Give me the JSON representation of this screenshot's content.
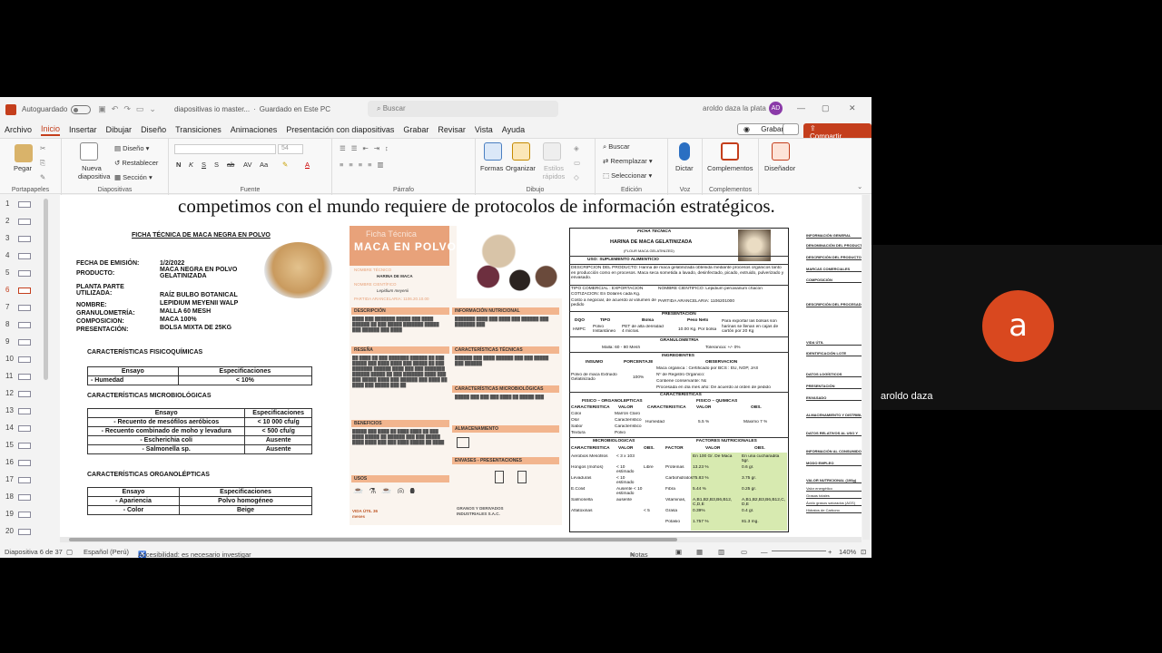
{
  "titlebar": {
    "autosave": "Autoguardado",
    "filename": "diapositivas io master...",
    "saved": "Guardado en Este PC",
    "search_placeholder": "Buscar",
    "user": "aroldo daza la plata",
    "avatar_initials": "AD"
  },
  "menu": {
    "items": [
      "Archivo",
      "Inicio",
      "Insertar",
      "Dibujar",
      "Diseño",
      "Transiciones",
      "Animaciones",
      "Presentación con diapositivas",
      "Grabar",
      "Revisar",
      "Vista",
      "Ayuda"
    ],
    "active": "Inicio",
    "grabar": "Grabar",
    "compartir": "Compartir"
  },
  "ribbon": {
    "pegar": "Pegar",
    "portapapeles": "Portapapeles",
    "nueva_diapositiva": "Nueva diapositiva",
    "diseno": "Diseño",
    "restablecer": "Restablecer",
    "seccion": "Sección",
    "diapositivas": "Diapositivas",
    "fuente": "Fuente",
    "font_size": "54",
    "parrafo": "Párrafo",
    "formas": "Formas",
    "organizar": "Organizar",
    "estilos_rapidos": "Estilos rápidos",
    "dibujo": "Dibujo",
    "buscar": "Buscar",
    "reemplazar": "Reemplazar",
    "seleccionar": "Seleccionar",
    "edicion": "Edición",
    "dictar": "Dictar",
    "voz": "Voz",
    "complementos": "Complementos",
    "complementos_group": "Complementos",
    "disenador": "Diseñador"
  },
  "thumbnails": [
    "1",
    "2",
    "3",
    "4",
    "5",
    "6",
    "7",
    "8",
    "9",
    "10",
    "11",
    "12",
    "13",
    "14",
    "15",
    "16",
    "17",
    "18",
    "19",
    "20"
  ],
  "selected_thumbnail": "6",
  "slide": {
    "heading": "competimos con el mundo requiere de protocolos de  información estratégicos.",
    "doc1": {
      "title": "FICHA TÉCNICA DE MACA NEGRA EN POLVO",
      "fields": [
        {
          "label": "FECHA DE EMISIÓN:",
          "value": "1/2/2022"
        },
        {
          "label": "PRODUCTO:",
          "value": "MACA NEGRA EN POLVO GELATINIZADA"
        },
        {
          "label": "PLANTA PARTE UTILIZADA:",
          "value": "RAÍZ BULBO BOTANICAL"
        },
        {
          "label": "NOMBRE:",
          "value": "LEPIDIUM MEYENII WALP"
        },
        {
          "label": "GRANULOMETRÍA:",
          "value": "MALLA 60 MESH"
        },
        {
          "label": "COMPOSICION:",
          "value": "MACA 100%"
        },
        {
          "label": "PRESENTACIÓN:",
          "value": "BOLSA MIXTA DE 25KG"
        }
      ],
      "fisico_title": "CARACTERÍSTICAS FISICOQUÍMICAS",
      "fisico_headers": [
        "Ensayo",
        "Especificaciones"
      ],
      "fisico_rows": [
        [
          "- Humedad",
          "< 10%"
        ]
      ],
      "micro_title": "CARACTERÍSTICAS MICROBIOLÓGICAS",
      "micro_headers": [
        "Ensayo",
        "Especificaciones"
      ],
      "micro_rows": [
        [
          "- Recuento de mesófilos aeróbicos",
          "< 10 000 cfu/g"
        ],
        [
          "- Recuento combinado de moho y levadura",
          "< 500 cfu/g"
        ],
        [
          "- Escherichia coli",
          "Ausente"
        ],
        [
          "- Salmonella sp.",
          "Ausente"
        ]
      ],
      "organo_title": "CARACTERÍSTICAS ORGANOLÉPTICAS",
      "organo_headers": [
        "Ensayo",
        "Especificaciones"
      ],
      "organo_rows": [
        [
          "- Apariencia",
          "Polvo homogéneo"
        ],
        [
          "- Color",
          "Beige"
        ]
      ]
    },
    "doc2": {
      "banner_small": "Ficha Técnica",
      "banner_big": "MACA EN POLVO",
      "nombre_tecnico_label": "NOMBRE TÉCNICO",
      "nombre_tecnico": "HARINA DE MACA",
      "nombre_cientifico_label": "NOMBRE CIENTÍFICO",
      "nombre_cientifico": "Lepidium meyenii",
      "partida": "PARTIDA ARANCELARIA: 1106.20.10.00",
      "sections": [
        "DESCRIPCIÓN",
        "INFORMACIÓN NUTRICIONAL",
        "RESEÑA",
        "CARACTERÍSTICAS TÉCNICAS",
        "CARACTERÍSTICAS MICROBIOLÓGICAS",
        "BENEFICIOS",
        "ALMACENAMIENTO",
        "ENVASES - PRESENTACIONES",
        "USOS"
      ],
      "vida_util": "VIDA ÚTIL 36 meses",
      "company": "GRANOS Y DERIVADOS INDUSTRIALES S.A.C."
    },
    "doc3": {
      "title": "FICHA TECNICA",
      "product": "HARINA DE MACA GELATINIZADA",
      "flour": "(FLOUR MACA GELATINIZED)",
      "uso": "USO: SUPLEMENTO ALIMENTICIO",
      "descripcion": "DESCRIPCION DEL PRODUCTO: Harina de maca gelatinizada obtenida mediante procesos orgánicos tanto en producción como en procesos. Maca seca sometida a lavado, desinfectado, picado, extruido, pulverizado y envasado.",
      "tipo_comercial": "TIPO COMERCIAL : EXPORTACION",
      "nombre_cientifico": "NOMBRE CIENTIFICO: Lepidium peruvianum chacón",
      "cotizacion": "COTIZACION: En Dólares cada Kg.",
      "costo": "Costo a negociar, de acuerdo al volumen de pedido",
      "partida": "PARTIDA ARANCELARIA: 1106201000",
      "presentacion": "PRESENTACIÓN",
      "pres_headers": [
        "DQO",
        "TIPO",
        "Bolsa",
        "Peso Neto"
      ],
      "pres_row": [
        "HMPC",
        "Polvo Instantáneo",
        "PET de alta densidad 4 micras.",
        "10.00 Kg. Por bolsa"
      ],
      "pres_note": "Para exportar las bolsas son harinas se llenan en cajas de cartón por 20 Kg",
      "granulometria": "GRANULOMETRIA",
      "malla": "Malla: 60 - 80 Mesh",
      "tolerancia": "Tolerancia: +/- 0%",
      "ingredientes": "INGREDIENTES",
      "ing_headers": [
        "INSUMO",
        "PORCENTAJE",
        "OBSERVACION"
      ],
      "insumo": "Polvo de maca Extruido Gelatinizado",
      "porcentaje": "100%",
      "observaciones": [
        "Maca orgánica : Certificado por BCS : EU, NOP, JAS",
        "Nº de Registro Orgánico:",
        "Contiene conservante:                No",
        "Procesada en día mes año:     De acuerdo al orden de pedido"
      ],
      "caracteristicas": "CARACTERISTICAS",
      "fisico_organo": "FISICO – ORGANOLEPTICAS",
      "fisico_quimicas": "FISICO – QUIMICAS",
      "fo_headers": [
        "CARACTERISTICA",
        "VALOR",
        "CARACTERISTICA",
        "VALOR",
        "OBS."
      ],
      "fo_rows": [
        [
          "Color",
          "Marrón Claro"
        ],
        [
          "Olor",
          "Característico"
        ],
        [
          "Sabor",
          "Característico"
        ],
        [
          "Textura",
          "Polvo"
        ]
      ],
      "humedad": "Humedad",
      "humedad_val": "5.5 %",
      "humedad_obs": "Máximo 7 %",
      "microbiologicas": "MICROBIOLOGICAS",
      "factores": "FACTORES NUTRICIONALES",
      "mb_headers": [
        "CARACTERISTICA",
        "VALOR",
        "OBS.",
        "FACTOR",
        "VALOR",
        "OBS."
      ],
      "mb_rows": [
        [
          "Aerobios Mesófilos",
          "< 3 x 103",
          "",
          "",
          "En 100 Gr. De Maca",
          "En una cucharadita 5gr."
        ],
        [
          "Hongos (mohos)",
          "< 10 estimado",
          "Libre",
          "Proteínas",
          "13.23 %",
          "0.6 gr."
        ],
        [
          "Levaduras",
          "< 10 estimado",
          "",
          "Carbohidratos",
          "75.83 %",
          "3.75 gr."
        ],
        [
          "E.Coli4",
          "Ausente < 10 estimado",
          "",
          "Fibra",
          "5.44 %",
          "0.25 gr."
        ],
        [
          "Salmonella",
          "ausente",
          "",
          "Vitaminas,",
          "A,B1,B2,B3,B6,B12, C,D,E",
          "A,B1,B2,B3,B6,B12,C, D,E"
        ],
        [
          "Aflatoxinas",
          "",
          "< 5",
          "Grasa",
          "0.39%",
          "0.4 gr."
        ],
        [
          "",
          "",
          "",
          "Potasio",
          "1.757 %",
          "81.3 mg."
        ]
      ]
    },
    "doc4": {
      "items": [
        "INFORMACIÓN GENERAL",
        "DENOMINACIÓN DEL PRODUCTO",
        "DESCRIPCIÓN DEL PRODUCTO",
        "MARCAS COMERCIALES",
        "COMPOSICIÓN",
        "DESCRIPCIÓN DEL PROCESADO",
        "VIDA ÚTIL",
        "IDENTIFICACIÓN LOTE",
        "DATOS LOGÍSTICOS",
        "PRESENTACIÓN",
        "ENVASADO",
        "ALMACENAMIENTO Y DISTRIBUCIÓN",
        "DATOS RELATIVOS AL USO Y",
        "INFORMACIÓN AL CONSUMIDOR",
        "MODO EMPLEO",
        "VALOR NUTRICIONAL (100g)",
        "Valor energético",
        "Grasas totales",
        "Ácido grasos saturados (AGS)",
        "Hidratos de Carbono"
      ]
    }
  },
  "status": {
    "slide_info": "Diapositiva 6 de 37",
    "language": "Español (Perú)",
    "accessibility": "Accesibilidad: es necesario investigar",
    "notes": "Notas",
    "zoom": "140%"
  },
  "participant": {
    "initial": "a",
    "name": "aroldo daza",
    "avatar_color": "#d9481f"
  }
}
